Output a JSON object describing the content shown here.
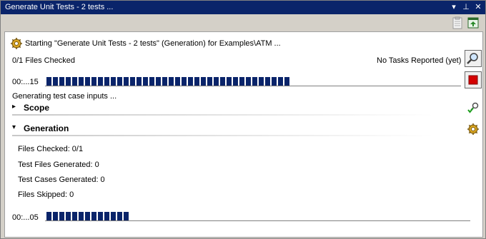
{
  "window": {
    "title": "Generate Unit Tests - 2 tests ..."
  },
  "titlebar_buttons": [
    "▾",
    "⊥",
    "✕"
  ],
  "status": {
    "starting_text": "Starting \"Generate Unit Tests - 2 tests\" (Generation) for Examples\\ATM ...",
    "files_checked": "0/1 Files Checked",
    "tasks_reported": "No Tasks Reported (yet)"
  },
  "main_progress": {
    "time": "00:...15",
    "fraction": 0.6
  },
  "generating_text": "Generating test case inputs ...",
  "scope": {
    "label": "Scope",
    "expanded": false
  },
  "generation": {
    "label": "Generation",
    "expanded": true,
    "stats": [
      "Files Checked: 0/1",
      "Test Files Generated: 0",
      "Test Cases Generated: 0",
      "Files Skipped: 0"
    ],
    "time": "00:...05",
    "fraction": 0.2
  },
  "colors": {
    "titlebar": "#0a246a",
    "progress": "#0a246a",
    "stop": "#d40000"
  },
  "icons": {
    "toolbar": [
      "clipboard-icon",
      "export-icon"
    ],
    "side": [
      "find-icon",
      "stop-icon",
      "check-key-icon",
      "gear-icon"
    ]
  }
}
